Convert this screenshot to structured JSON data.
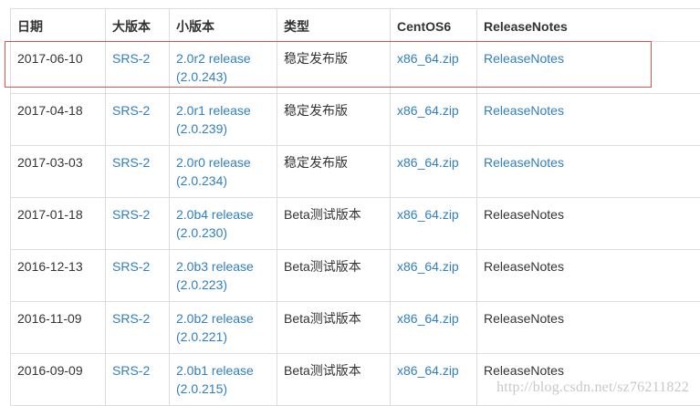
{
  "table": {
    "headers": [
      "日期",
      "大版本",
      "小版本",
      "类型",
      "CentOS6",
      "ReleaseNotes"
    ],
    "rows": [
      {
        "date": "2017-06-10",
        "major": "SRS-2",
        "minor_line1": "2.0r2 release",
        "minor_line2": "(2.0.243)",
        "type": "稳定发布版",
        "centos": "x86_64.zip",
        "notes": "ReleaseNotes",
        "notes_link": true
      },
      {
        "date": "2017-04-18",
        "major": "SRS-2",
        "minor_line1": "2.0r1 release",
        "minor_line2": "(2.0.239)",
        "type": "稳定发布版",
        "centos": "x86_64.zip",
        "notes": "ReleaseNotes",
        "notes_link": true
      },
      {
        "date": "2017-03-03",
        "major": "SRS-2",
        "minor_line1": "2.0r0 release",
        "minor_line2": "(2.0.234)",
        "type": "稳定发布版",
        "centos": "x86_64.zip",
        "notes": "ReleaseNotes",
        "notes_link": true
      },
      {
        "date": "2017-01-18",
        "major": "SRS-2",
        "minor_line1": "2.0b4 release",
        "minor_line2": "(2.0.230)",
        "type": "Beta测试版本",
        "centos": "x86_64.zip",
        "notes": "ReleaseNotes",
        "notes_link": false
      },
      {
        "date": "2016-12-13",
        "major": "SRS-2",
        "minor_line1": "2.0b3 release",
        "minor_line2": "(2.0.223)",
        "type": "Beta测试版本",
        "centos": "x86_64.zip",
        "notes": "ReleaseNotes",
        "notes_link": false
      },
      {
        "date": "2016-11-09",
        "major": "SRS-2",
        "minor_line1": "2.0b2 release",
        "minor_line2": "(2.0.221)",
        "type": "Beta测试版本",
        "centos": "x86_64.zip",
        "notes": "ReleaseNotes",
        "notes_link": false
      },
      {
        "date": "2016-09-09",
        "major": "SRS-2",
        "minor_line1": "2.0b1 release",
        "minor_line2": "(2.0.215)",
        "type": "Beta测试版本",
        "centos": "x86_64.zip",
        "notes": "ReleaseNotes",
        "notes_link": false
      }
    ]
  },
  "watermark": "http://blog.csdn.net/sz76211822",
  "colors": {
    "link": "#2f7fc1",
    "text": "#333333",
    "border": "#dddddd",
    "highlight": "#d9534f"
  }
}
